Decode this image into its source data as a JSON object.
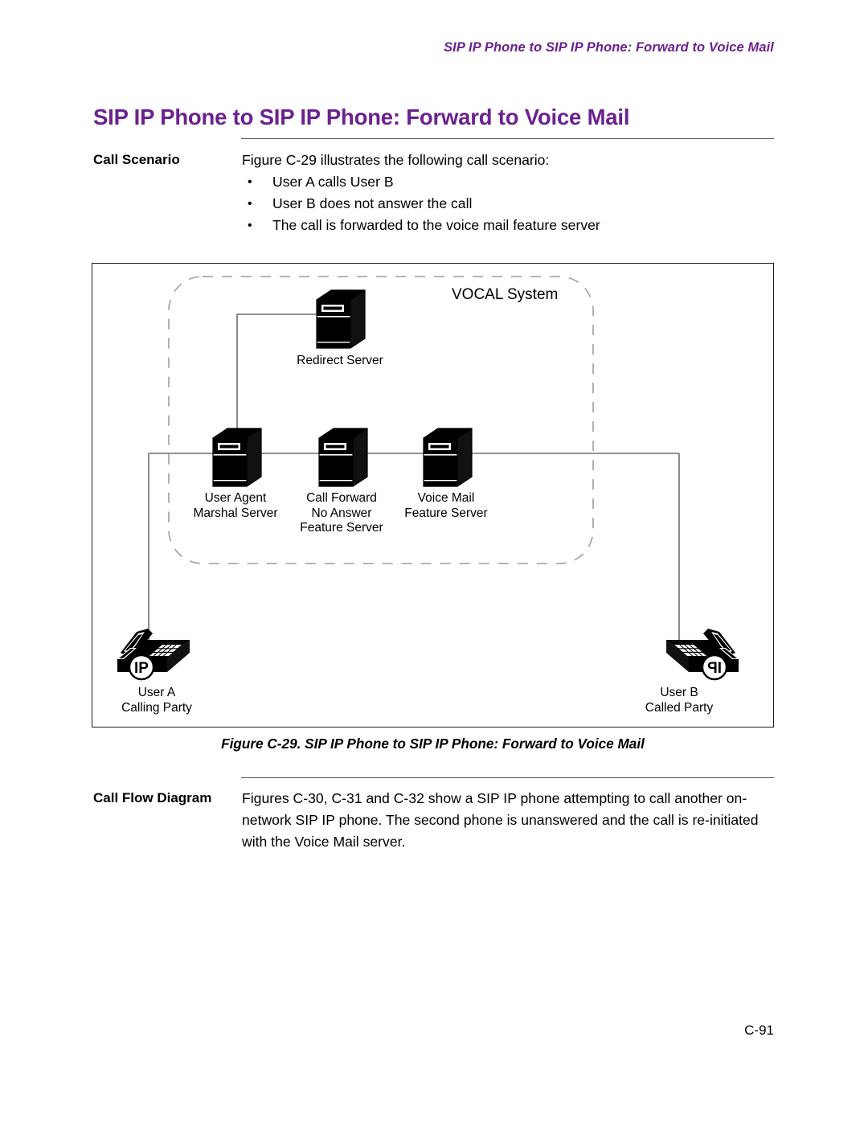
{
  "running_header": "SIP IP Phone to SIP IP Phone: Forward to Voice Mail",
  "page_title": "SIP IP Phone to SIP IP Phone: Forward to Voice Mail",
  "page_number": "C-91",
  "sections": [
    {
      "label": "Call Scenario",
      "intro": "Figure C-29 illustrates the following call scenario:",
      "bullet_marker": "•",
      "bullets": [
        "User A calls User B",
        "User B does not answer the call",
        "The call is forwarded to the voice mail feature server"
      ]
    },
    {
      "label": "Call Flow Diagram",
      "paragraph": "Figures C-30, C-31 and C-32 show a SIP IP phone attempting to call another on-network SIP IP phone. The second phone is unanswered and the call is re-initiated with the Voice Mail server."
    }
  ],
  "figure": {
    "caption": "Figure C-29. SIP IP Phone to SIP IP Phone: Forward to Voice Mail",
    "boundary_label": "VOCAL System",
    "nodes": [
      {
        "id": "redirect",
        "type": "server",
        "label": "Redirect Server"
      },
      {
        "id": "uams",
        "type": "server",
        "label": "User Agent\nMarshal Server"
      },
      {
        "id": "cfna",
        "type": "server",
        "label": "Call Forward\nNo Answer\nFeature Server"
      },
      {
        "id": "voicemail",
        "type": "server",
        "label": "Voice Mail\nFeature Server"
      },
      {
        "id": "user-a",
        "type": "ip-phone",
        "badge": "IP",
        "label": "User A\nCalling Party"
      },
      {
        "id": "user-b",
        "type": "ip-phone",
        "badge": "IP",
        "label": "User B\nCalled Party"
      }
    ],
    "links": [
      {
        "from": "redirect",
        "to": "uams"
      },
      {
        "from": "uams",
        "to": "cfna"
      },
      {
        "from": "cfna",
        "to": "voicemail"
      },
      {
        "from": "uams",
        "to": "user-a"
      },
      {
        "from": "voicemail",
        "to": "user-b"
      }
    ]
  },
  "colors": {
    "accent_purple": "#6B2290",
    "rule_gray": "#55565A",
    "frame_black": "#1B1B1B",
    "link_gray": "#6E6E6E",
    "dashed_gray": "#A9A9A9",
    "server_black": "#000000"
  }
}
